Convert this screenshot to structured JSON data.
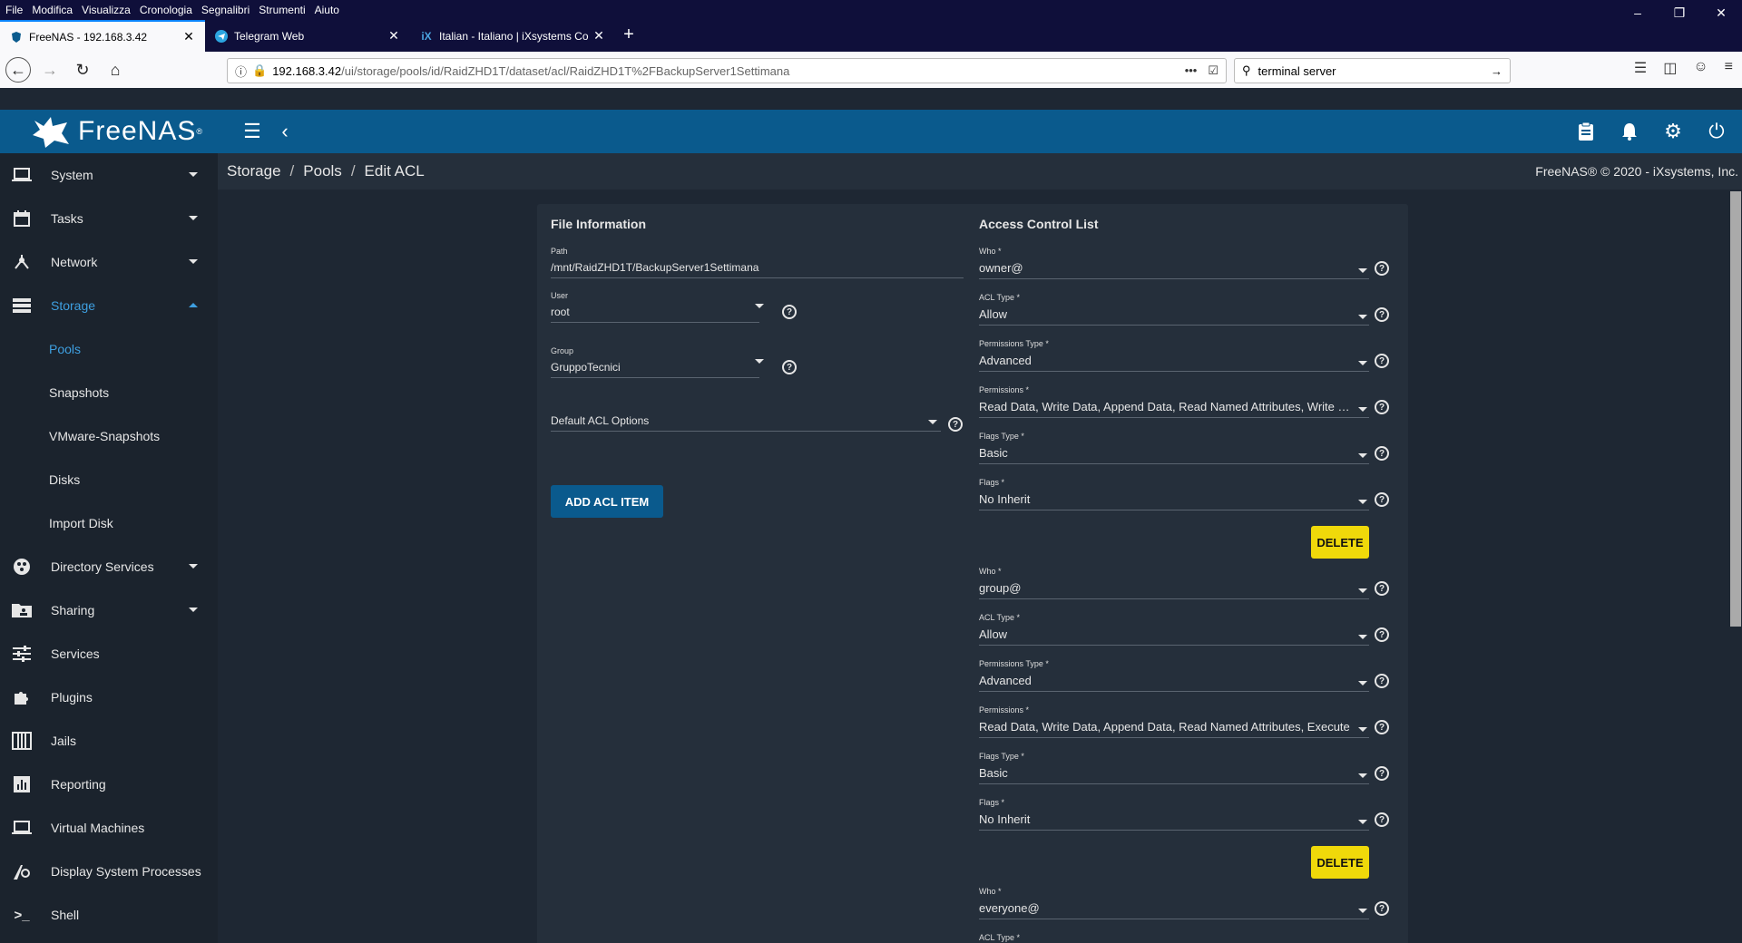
{
  "browser": {
    "menu": [
      "File",
      "Modifica",
      "Visualizza",
      "Cronologia",
      "Segnalibri",
      "Strumenti",
      "Aiuto"
    ],
    "tabs": [
      {
        "title": "FreeNAS - 192.168.3.42",
        "icon": "freenas-icon"
      },
      {
        "title": "Telegram Web",
        "icon": "telegram-icon"
      },
      {
        "title": "Italian - Italiano | iXsystems Co",
        "icon": "ixsystems-icon"
      }
    ],
    "url_host": "192.168.3.42",
    "url_path": "/ui/storage/pools/id/RaidZHD1T/dataset/acl/RaidZHD1T%2FBackupServer1Settimana",
    "search_value": "terminal server"
  },
  "app": {
    "logo": "FreeNAS",
    "logo_mark": "®",
    "breadcrumb": [
      "Storage",
      "Pools",
      "Edit ACL"
    ],
    "copyright": "FreeNAS® © 2020 - iXsystems, Inc."
  },
  "sidebar": {
    "items": [
      {
        "label": "System",
        "icon": "laptop-icon",
        "caret": "down"
      },
      {
        "label": "Tasks",
        "icon": "calendar-icon",
        "caret": "down"
      },
      {
        "label": "Network",
        "icon": "network-icon",
        "caret": "down"
      },
      {
        "label": "Storage",
        "icon": "storage-icon",
        "caret": "up",
        "active": true
      },
      {
        "label": "Pools",
        "sub": true,
        "active": true
      },
      {
        "label": "Snapshots",
        "sub": true
      },
      {
        "label": "VMware-Snapshots",
        "sub": true
      },
      {
        "label": "Disks",
        "sub": true
      },
      {
        "label": "Import Disk",
        "sub": true
      },
      {
        "label": "Directory Services",
        "icon": "directory-icon",
        "caret": "down"
      },
      {
        "label": "Sharing",
        "icon": "folder-share-icon",
        "caret": "down"
      },
      {
        "label": "Services",
        "icon": "tune-icon"
      },
      {
        "label": "Plugins",
        "icon": "puzzle-icon"
      },
      {
        "label": "Jails",
        "icon": "jail-icon"
      },
      {
        "label": "Reporting",
        "icon": "chart-icon"
      },
      {
        "label": "Virtual Machines",
        "icon": "monitor-icon"
      },
      {
        "label": "Display System Processes",
        "icon": "processes-icon"
      },
      {
        "label": "Shell",
        "icon": "terminal-icon"
      }
    ]
  },
  "file_info": {
    "title": "File Information",
    "path_label": "Path",
    "path_value": "/mnt/RaidZHD1T/BackupServer1Settimana",
    "user_label": "User",
    "user_value": "root",
    "group_label": "Group",
    "group_value": "GruppoTecnici",
    "default_acl_label": "Default ACL Options",
    "add_button": "ADD ACL ITEM"
  },
  "acl": {
    "title": "Access Control List",
    "labels": {
      "who": "Who *",
      "acl_type": "ACL Type *",
      "perm_type": "Permissions Type *",
      "perms": "Permissions *",
      "flags_type": "Flags Type *",
      "flags": "Flags *"
    },
    "delete_label": "DELETE",
    "entries": [
      {
        "who": "owner@",
        "acl_type": "Allow",
        "perm_type": "Advanced",
        "perms": "Read Data, Write Data, Append Data, Read Named Attributes, Write Named Attributes, Execute",
        "flags_type": "Basic",
        "flags": "No Inherit"
      },
      {
        "who": "group@",
        "acl_type": "Allow",
        "perm_type": "Advanced",
        "perms": "Read Data, Write Data, Append Data, Read Named Attributes, Execute",
        "flags_type": "Basic",
        "flags": "No Inherit"
      },
      {
        "who": "everyone@"
      }
    ]
  }
}
